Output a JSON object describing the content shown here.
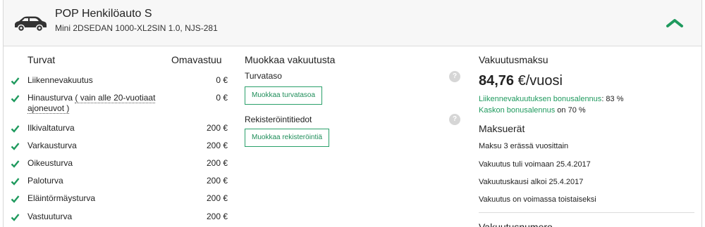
{
  "header": {
    "title": "POP Henkilöauto S",
    "subtitle": "Mini 2DSEDAN 1000-XL2SIN 1.0, NJS-281"
  },
  "coverage": {
    "heading": "Turvat",
    "deductible_heading": "Omavastuu",
    "items": [
      {
        "label": "Liikennevakuutus",
        "value": "0 €"
      },
      {
        "label": "Hinausturva",
        "link": "( vain alle 20-vuotiaat ajoneuvot )",
        "value": "0 €"
      },
      {
        "label": "Ilkivaltaturva",
        "value": "200 €"
      },
      {
        "label": "Varkausturva",
        "value": "200 €"
      },
      {
        "label": "Oikeusturva",
        "value": "200 €"
      },
      {
        "label": "Paloturva",
        "value": "200 €"
      },
      {
        "label": "Eläintörmäysturva",
        "value": "200 €"
      },
      {
        "label": "Vastuuturva",
        "value": "200 €"
      }
    ]
  },
  "edit": {
    "heading": "Muokkaa vakuutusta",
    "level_label": "Turvataso",
    "level_button": "Muokkaa turvatasoa",
    "reg_label": "Rekisteröintitiedot",
    "reg_button": "Muokkaa rekisteröintiä",
    "help_glyph": "?"
  },
  "payment": {
    "heading": "Vakuutusmaksu",
    "amount": "84,76",
    "unit": " €/vuosi",
    "bonus1_label": "Liikennevakuutuksen bonusalennus",
    "bonus1_value": ": 83 %",
    "bonus2_label": "Kaskon bonusalennus",
    "bonus2_value": " on 70 %",
    "installments_heading": "Maksuerät",
    "lines": [
      "Maksu 3 erässä vuosittain",
      "Vakuutus tuli voimaan 25.4.2017",
      "Vakuutuskausi alkoi 25.4.2017",
      "Vakuutus on voimassa toistaiseksi"
    ],
    "next_heading": "Vakuutusnumero"
  },
  "colors": {
    "accent": "#1f9a5e",
    "header_bg": "#f7f7f7"
  },
  "icons": {
    "car": "car-icon",
    "collapse": "chevron-up-icon",
    "check": "check-icon",
    "help": "help-icon"
  }
}
